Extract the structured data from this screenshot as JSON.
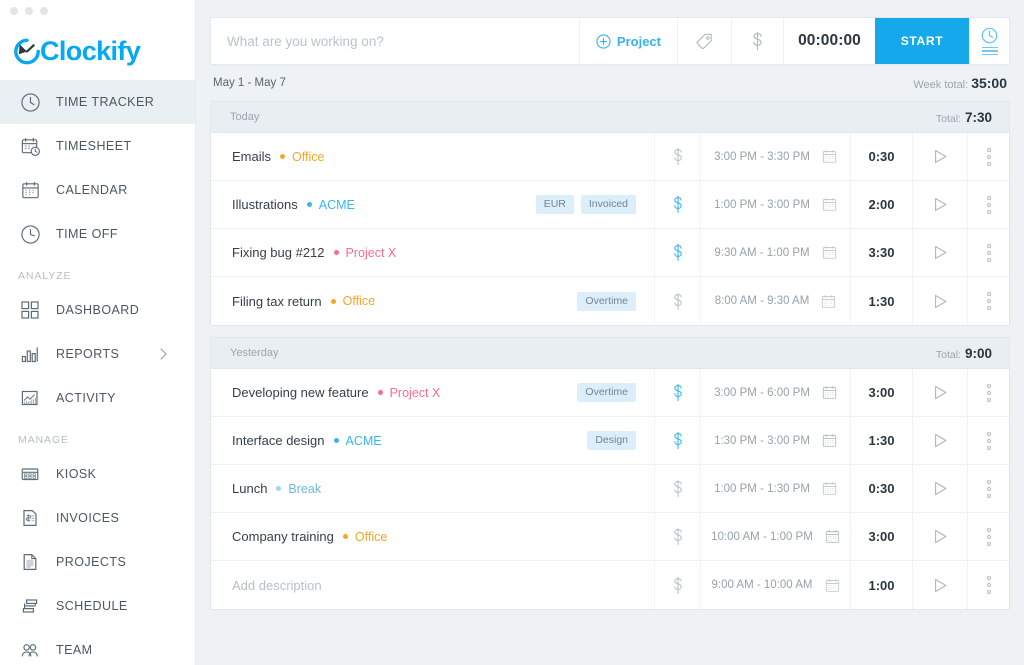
{
  "window": {
    "dots": 3
  },
  "brand": {
    "name": "Clockify",
    "color": "#03a9f4",
    "logo_icon": "clock-c-logo"
  },
  "sidebar": {
    "items": [
      {
        "label": "TIME TRACKER",
        "icon": "clock-icon",
        "active": true
      },
      {
        "label": "TIMESHEET",
        "icon": "calendar-clock-icon",
        "active": false
      },
      {
        "label": "CALENDAR",
        "icon": "calendar-icon",
        "active": false
      },
      {
        "label": "TIME OFF",
        "icon": "clock-off-icon",
        "active": false
      }
    ],
    "sections": [
      {
        "title": "ANALYZE",
        "items": [
          {
            "label": "DASHBOARD",
            "icon": "grid-icon",
            "chevron": false
          },
          {
            "label": "REPORTS",
            "icon": "bar-chart-icon",
            "chevron": true
          },
          {
            "label": "ACTIVITY",
            "icon": "activity-chart-icon",
            "chevron": false
          }
        ]
      },
      {
        "title": "MANAGE",
        "items": [
          {
            "label": "KIOSK",
            "icon": "kiosk-icon",
            "chevron": false
          },
          {
            "label": "INVOICES",
            "icon": "invoice-icon",
            "chevron": false
          },
          {
            "label": "PROJECTS",
            "icon": "document-icon",
            "chevron": false
          },
          {
            "label": "SCHEDULE",
            "icon": "schedule-icon",
            "chevron": false
          },
          {
            "label": "TEAM",
            "icon": "team-icon",
            "chevron": false
          }
        ]
      }
    ]
  },
  "timer": {
    "placeholder": "What are you working on?",
    "value": "",
    "project_label": "Project",
    "project_icon": "plus-circle-icon",
    "tag_icon": "tag-icon",
    "billable_icon": "dollar-icon",
    "duration": "00:00:00",
    "start_label": "START",
    "mode_icon": "timer-mode-icon",
    "accent": "#15a9ec"
  },
  "week": {
    "range": "May 1 - May 7",
    "total_label": "Week total:",
    "total_value": "35:00"
  },
  "groups": [
    {
      "label": "Today",
      "total_label": "Total:",
      "total_value": "7:30",
      "entries": [
        {
          "description": "Emails",
          "placeholder": "",
          "project": "Office",
          "project_color": "#f5a623",
          "tags": [],
          "billable": false,
          "time_range": "3:00 PM - 3:30 PM",
          "duration": "0:30"
        },
        {
          "description": "Illustrations",
          "placeholder": "",
          "project": "ACME",
          "project_color": "#36b7ef",
          "tags": [
            "EUR",
            "Invoiced"
          ],
          "billable": true,
          "time_range": "1:00 PM - 3:00 PM",
          "duration": "2:00"
        },
        {
          "description": "Fixing bug #212",
          "placeholder": "",
          "project": "Project X",
          "project_color": "#fb6b8e",
          "tags": [],
          "billable": true,
          "time_range": "9:30 AM - 1:00 PM",
          "duration": "3:30"
        },
        {
          "description": "Filing tax return",
          "placeholder": "",
          "project": "Office",
          "project_color": "#f5a623",
          "tags": [
            "Overtime"
          ],
          "billable": false,
          "time_range": "8:00 AM - 9:30 AM",
          "duration": "1:30"
        }
      ]
    },
    {
      "label": "Yesterday",
      "total_label": "Total:",
      "total_value": "9:00",
      "entries": [
        {
          "description": "Developing new feature",
          "placeholder": "",
          "project": "Project X",
          "project_color": "#fb6b8e",
          "tags": [
            "Overtime"
          ],
          "billable": true,
          "time_range": "3:00 PM - 6:00 PM",
          "duration": "3:00"
        },
        {
          "description": "Interface design",
          "placeholder": "",
          "project": "ACME",
          "project_color": "#36b7ef",
          "tags": [
            "Design"
          ],
          "billable": true,
          "time_range": "1:30 PM - 3:00 PM",
          "duration": "1:30"
        },
        {
          "description": "Lunch",
          "placeholder": "",
          "project": "Break",
          "project_color": "#9fd4ef",
          "tags": [],
          "billable": false,
          "time_range": "1:00 PM - 1:30 PM",
          "duration": "0:30"
        },
        {
          "description": "Company training",
          "placeholder": "",
          "project": "Office",
          "project_color": "#f5a623",
          "tags": [],
          "billable": false,
          "time_range": "10:00 AM - 1:00 PM",
          "duration": "3:00"
        },
        {
          "description": "",
          "placeholder": "Add description",
          "project": "",
          "project_color": "",
          "tags": [],
          "billable": false,
          "time_range": "9:00 AM - 10:00 AM",
          "duration": "1:00"
        }
      ]
    }
  ],
  "icons": {
    "calendar_small": "calendar-icon",
    "play": "play-icon",
    "more": "more-vertical-icon"
  }
}
